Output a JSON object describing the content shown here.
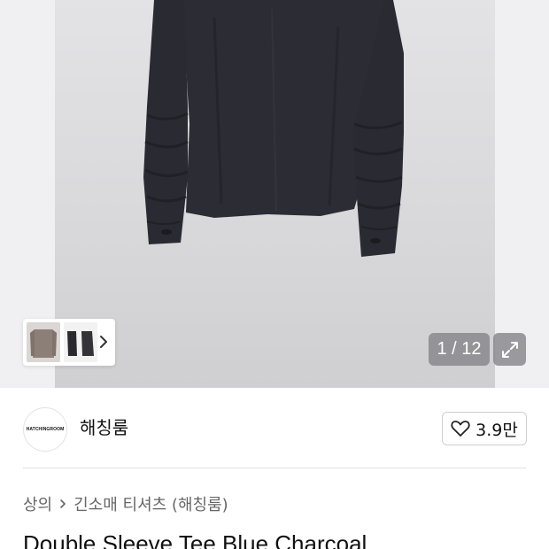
{
  "gallery": {
    "counter": "1 / 12",
    "thumbnails": [
      "grey-shirt-thumb",
      "black-shirts-thumb"
    ],
    "expand_icon": "expand-icon",
    "next_icon": "chevron-right-icon"
  },
  "brand": {
    "logo_text": "HATCHINGROOM",
    "name": "해칭룸",
    "like_icon": "heart-icon",
    "like_count": "3.9만"
  },
  "breadcrumb": {
    "category": "상의",
    "subcategory": "긴소매 티셔츠 (해칭룸)"
  },
  "product": {
    "title": "Double Sleeve Tee Blue Charcoal"
  },
  "colors": {
    "shirt": "#2c2d34",
    "background": "#dcdcdf",
    "overlay": "#8a8a8e"
  }
}
